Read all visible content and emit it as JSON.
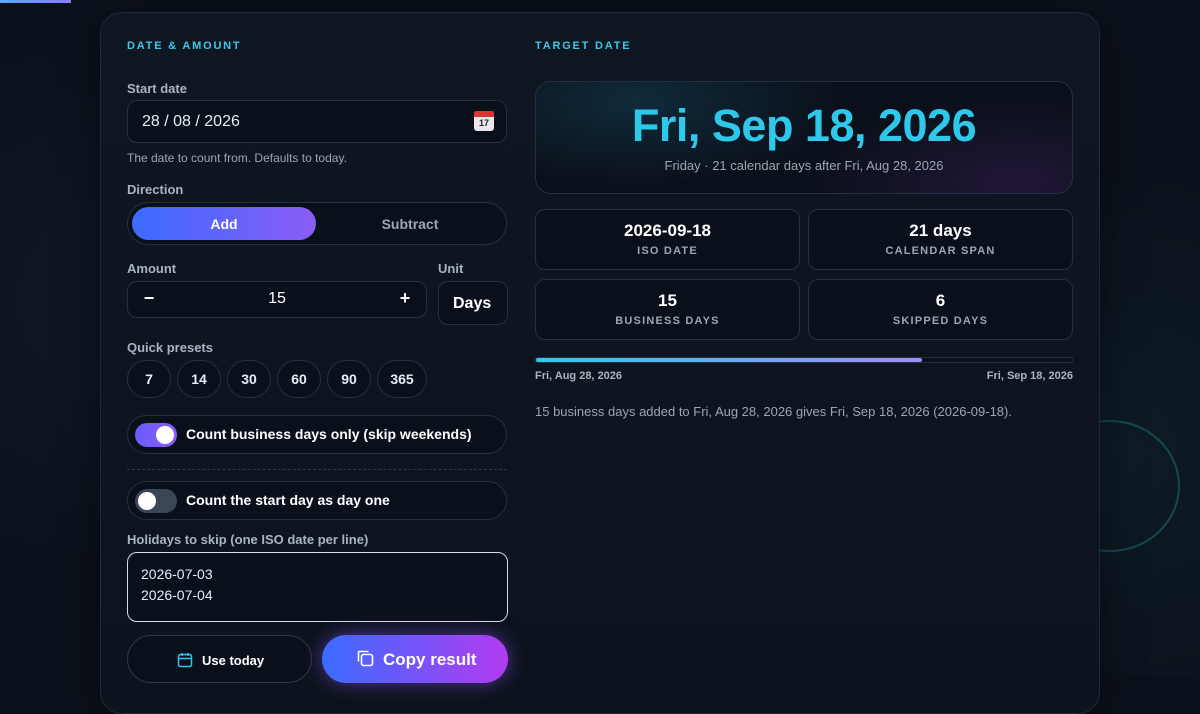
{
  "left": {
    "section_title": "DATE & AMOUNT",
    "start_date": {
      "label": "Start date",
      "value": "28 / 08 / 2026",
      "calendar_number": "17",
      "hint": "The date to count from. Defaults to today."
    },
    "direction": {
      "label": "Direction",
      "options": [
        "Add",
        "Subtract"
      ],
      "selected": "Add"
    },
    "amount": {
      "label": "Amount",
      "value": "15",
      "minus": "−",
      "plus": "+"
    },
    "unit": {
      "label": "Unit",
      "value": "Days"
    },
    "presets": {
      "label": "Quick presets",
      "values": [
        "7",
        "14",
        "30",
        "60",
        "90",
        "365"
      ]
    },
    "toggles": [
      {
        "label": "Count business days only (skip weekends)",
        "on": true
      },
      {
        "label": "Count the start day as day one",
        "on": false
      }
    ],
    "holidays": {
      "label": "Holidays to skip (one ISO date per line)",
      "lines": [
        "2026-07-03",
        "2026-07-04"
      ]
    },
    "buttons": {
      "use_today": "Use today",
      "copy_result": "Copy result"
    }
  },
  "right": {
    "section_title": "TARGET DATE",
    "result": {
      "date": "Fri, Sep 18, 2026",
      "detail": "Friday · 21 calendar days after Fri, Aug 28, 2026"
    },
    "stats": [
      {
        "value": "2026-09-18",
        "key": "ISO DATE"
      },
      {
        "value": "21 days",
        "key": "CALENDAR SPAN"
      },
      {
        "value": "15",
        "key": "BUSINESS DAYS"
      },
      {
        "value": "6",
        "key": "SKIPPED DAYS"
      }
    ],
    "progress": {
      "fraction": 0.72,
      "start_label": "Fri, Aug 28, 2026",
      "end_label": "Fri, Sep 18, 2026"
    },
    "summary": "15 business days added to Fri, Aug 28, 2026 gives Fri, Sep 18, 2026 (2026-09-18)."
  },
  "colors": {
    "accent": "#2ec8ea",
    "primary_gradient_start": "#3b6cff",
    "primary_gradient_end": "#8a5cf6"
  }
}
